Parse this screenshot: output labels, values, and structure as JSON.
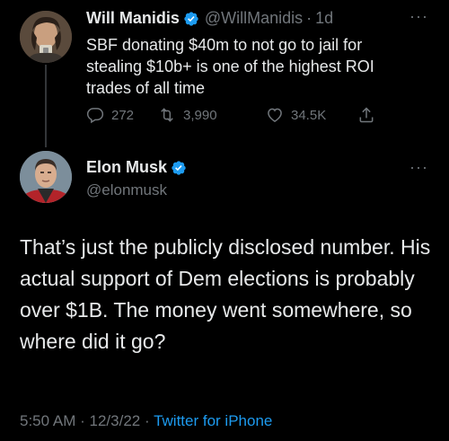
{
  "quoted_tweet": {
    "display_name": "Will Manidis",
    "handle": "@WillManidis",
    "separator": "·",
    "time": "1d",
    "text": "SBF donating $40m to not go to jail for stealing $10b+ is one of the highest ROI trades of all time",
    "replies": "272",
    "retweets": "3,990",
    "likes": "34.5K"
  },
  "main_tweet": {
    "display_name": "Elon Musk",
    "handle": "@elonmusk",
    "text": "That’s just the publicly disclosed number. His actual support of Dem elections is probably over $1B. The money went somewhere, so where did it go?",
    "time": "5:50 AM",
    "separator": "·",
    "date": "12/3/22",
    "source": "Twitter for iPhone"
  },
  "more_label": "···",
  "colors": {
    "background": "#000000",
    "text": "#e7e9ea",
    "muted": "#71767b",
    "accent": "#1d9bf0"
  },
  "icons": [
    "verified-badge-icon",
    "reply-icon",
    "retweet-icon",
    "like-icon",
    "share-icon",
    "more-icon"
  ]
}
